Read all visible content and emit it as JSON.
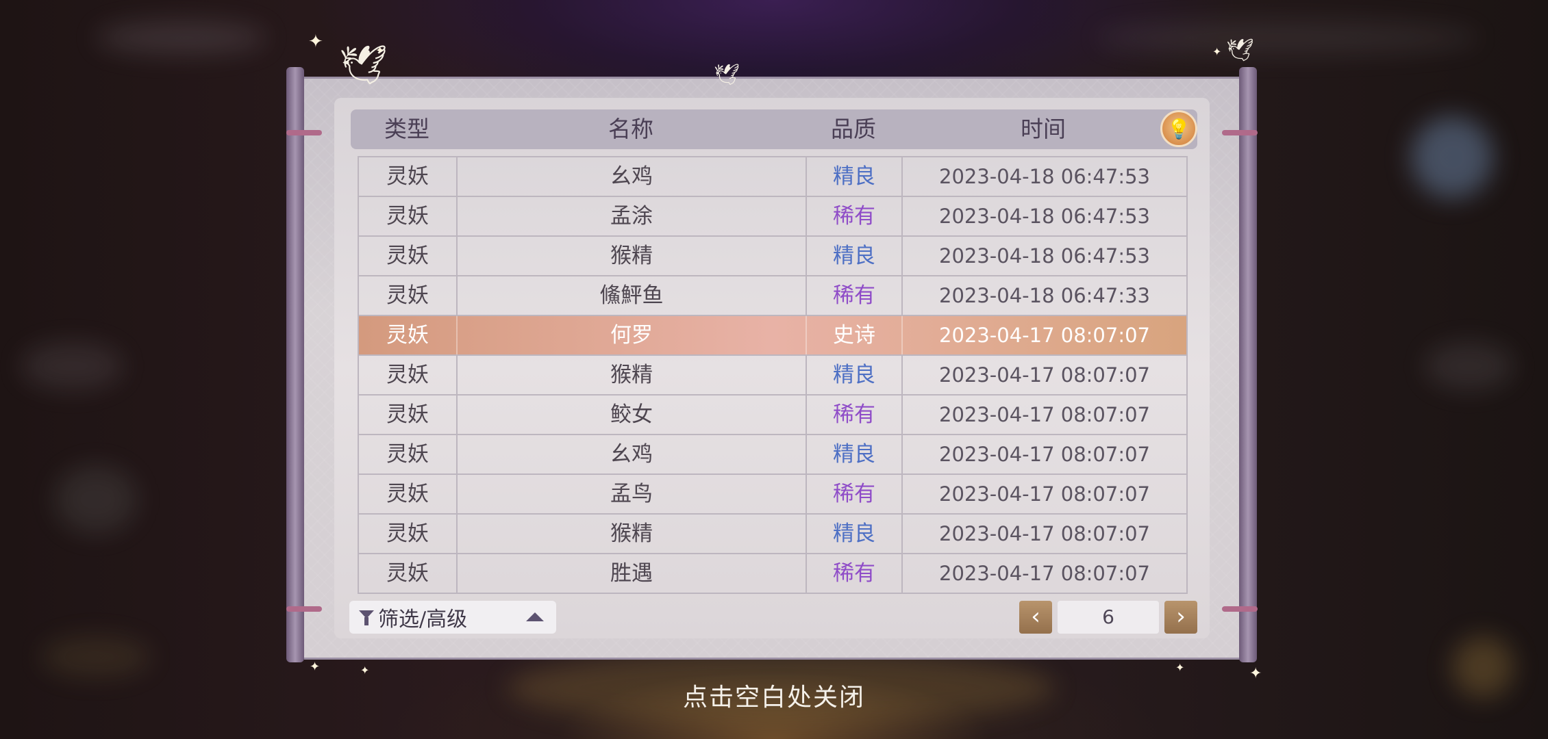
{
  "header": {
    "columns": [
      "类型",
      "名称",
      "品质",
      "时间"
    ],
    "hint_icon": "lightbulb-icon"
  },
  "colors": {
    "quality_fine": "#4d6fc4",
    "quality_rare": "#8f4cc8",
    "highlight_row": "#e0a894",
    "header_bar": "#b8b2bf"
  },
  "rows": [
    {
      "type": "灵妖",
      "name": "幺鸡",
      "quality": "精良",
      "time": "2023-04-18  06:47:53"
    },
    {
      "type": "灵妖",
      "name": "孟涂",
      "quality": "稀有",
      "time": "2023-04-18  06:47:53"
    },
    {
      "type": "灵妖",
      "name": "猴精",
      "quality": "精良",
      "time": "2023-04-18  06:47:53"
    },
    {
      "type": "灵妖",
      "name": "鯈鮃鱼",
      "quality": "稀有",
      "time": "2023-04-18  06:47:33"
    },
    {
      "type": "灵妖",
      "name": "何罗",
      "quality": "史诗",
      "time": "2023-04-17  08:07:07"
    },
    {
      "type": "灵妖",
      "name": "猴精",
      "quality": "精良",
      "time": "2023-04-17  08:07:07"
    },
    {
      "type": "灵妖",
      "name": "鲛女",
      "quality": "稀有",
      "time": "2023-04-17  08:07:07"
    },
    {
      "type": "灵妖",
      "name": "幺鸡",
      "quality": "精良",
      "time": "2023-04-17  08:07:07"
    },
    {
      "type": "灵妖",
      "name": "孟鸟",
      "quality": "稀有",
      "time": "2023-04-17  08:07:07"
    },
    {
      "type": "灵妖",
      "name": "猴精",
      "quality": "精良",
      "time": "2023-04-17  08:07:07"
    },
    {
      "type": "灵妖",
      "name": "胜遇",
      "quality": "稀有",
      "time": "2023-04-17  08:07:07"
    }
  ],
  "footer": {
    "filter_label": "筛选/高级",
    "filter_icon": "filter-icon",
    "dropdown_icon": "triangle-up-icon",
    "prev_icon": "chevron-left-icon",
    "next_icon": "chevron-right-icon",
    "page": "6"
  },
  "close_hint": "点击空白处关闭"
}
